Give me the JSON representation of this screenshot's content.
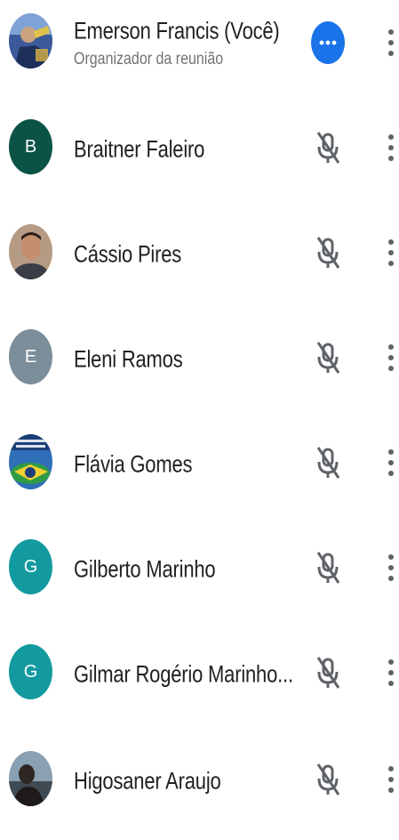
{
  "participants": [
    {
      "name": "Emerson Francis (Você)",
      "subtitle": "Organizador da reunião",
      "avatar": {
        "type": "photo",
        "initial": "",
        "color": "#5a6e9a",
        "icon": "user-photo"
      },
      "status_icon": "more-horiz-icon",
      "status_color": "#1a73e8"
    },
    {
      "name": "Braitner Faleiro",
      "subtitle": "",
      "avatar": {
        "type": "initial",
        "initial": "B",
        "color": "#0b5345",
        "icon": ""
      },
      "status_icon": "mic-off-icon",
      "status_color": "#5f6368"
    },
    {
      "name": "Cássio Pires",
      "subtitle": "",
      "avatar": {
        "type": "photo",
        "initial": "",
        "color": "#8a6a55",
        "icon": "user-photo"
      },
      "status_icon": "mic-off-icon",
      "status_color": "#5f6368"
    },
    {
      "name": "Eleni Ramos",
      "subtitle": "",
      "avatar": {
        "type": "initial",
        "initial": "E",
        "color": "#7d8e9b",
        "icon": ""
      },
      "status_icon": "mic-off-icon",
      "status_color": "#5f6368"
    },
    {
      "name": "Flávia Gomes",
      "subtitle": "",
      "avatar": {
        "type": "photo",
        "initial": "",
        "color": "#3d8f45",
        "icon": "user-photo"
      },
      "status_icon": "mic-off-icon",
      "status_color": "#5f6368"
    },
    {
      "name": "Gilberto Marinho",
      "subtitle": "",
      "avatar": {
        "type": "initial",
        "initial": "G",
        "color": "#129aa0",
        "icon": ""
      },
      "status_icon": "mic-off-icon",
      "status_color": "#5f6368"
    },
    {
      "name": "Gilmar Rogério Marinho...",
      "subtitle": "",
      "avatar": {
        "type": "initial",
        "initial": "G",
        "color": "#129aa0",
        "icon": ""
      },
      "status_icon": "mic-off-icon",
      "status_color": "#5f6368"
    },
    {
      "name": "Higosaner Araujo",
      "subtitle": "",
      "avatar": {
        "type": "photo",
        "initial": "",
        "color": "#4a5058",
        "icon": "user-photo"
      },
      "status_icon": "mic-off-icon",
      "status_color": "#5f6368"
    }
  ],
  "icons": {
    "kebab": "more-vert-icon",
    "kebab_color": "#5f6368"
  }
}
